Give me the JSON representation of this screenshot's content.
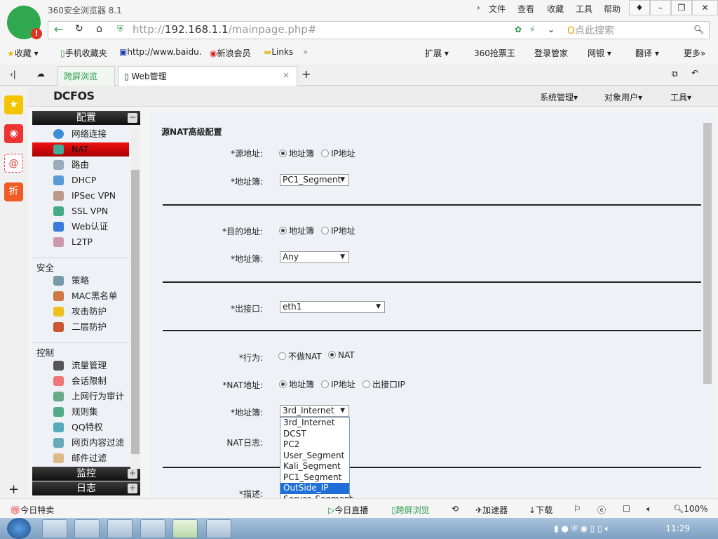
{
  "browser": {
    "title": "360安全浏览器 8.1",
    "menus": [
      "文件",
      "查看",
      "收藏",
      "工具",
      "帮助"
    ],
    "url_prefix": "http://",
    "url_host": "192.168.1.1",
    "url_path": "/mainpage.php#",
    "search_placeholder": "点此搜索",
    "bookmarks": [
      "收藏",
      "手机收藏夹",
      "http://www.baidu.",
      "新浪会员",
      "Links"
    ],
    "bookmarks_right": [
      "扩展",
      "360抢票王",
      "登录管家",
      "网银",
      "翻译",
      "更多"
    ],
    "tabs": [
      "跨屏浏览",
      "Web管理"
    ]
  },
  "app": {
    "brand": "DCFOS",
    "menus": [
      "系统管理▾",
      "对象用户▾",
      "工具▾"
    ]
  },
  "sidebar": {
    "sections": {
      "config": "配置",
      "monitor": "监控",
      "log": "日志"
    },
    "config_items": [
      "网络连接",
      "NAT",
      "路由",
      "DHCP",
      "IPSec VPN",
      "SSL VPN",
      "Web认证",
      "L2TP"
    ],
    "security_title": "安全",
    "security_items": [
      "策略",
      "MAC黑名单",
      "攻击防护",
      "二层防护"
    ],
    "control_title": "控制",
    "control_items": [
      "流量管理",
      "会话限制",
      "上网行为审计",
      "规则集",
      "QQ特权",
      "网页内容过滤",
      "邮件过滤"
    ]
  },
  "form": {
    "title": "源NAT高级配置",
    "src_label": "*源地址:",
    "src_opt1": "地址簿",
    "src_opt2": "IP地址",
    "src_book_label": "*地址簿:",
    "src_book_value": "PC1_Segment",
    "dst_label": "*目的地址:",
    "dst_opt1": "地址簿",
    "dst_opt2": "IP地址",
    "dst_book_label": "*地址簿:",
    "dst_book_value": "Any",
    "out_label": "*出接口:",
    "out_value": "eth1",
    "action_label": "*行为:",
    "action_opt1": "不做NAT",
    "action_opt2": "NAT",
    "nat_addr_label": "*NAT地址:",
    "nat_opt1": "地址簿",
    "nat_opt2": "IP地址",
    "nat_opt3": "出接口IP",
    "nat_book_label": "*地址簿:",
    "nat_book_value": "3rd_Internet",
    "nat_log_label": "NAT日志:",
    "desc_label": "*描述:",
    "dropdown_options": [
      "3rd_Internet",
      "DCST",
      "PC2",
      "User_Segment",
      "Kali_Segment",
      "PC1_Segment",
      "OutSide_IP",
      "Server_Segment"
    ],
    "dropdown_highlighted": "OutSide_IP"
  },
  "statusbar": {
    "left": "今日特卖",
    "items": [
      "今日直播",
      "跨屏浏览",
      "加速器",
      "下载"
    ],
    "zoom": "100%"
  },
  "taskbar": {
    "clock": "11:29"
  }
}
